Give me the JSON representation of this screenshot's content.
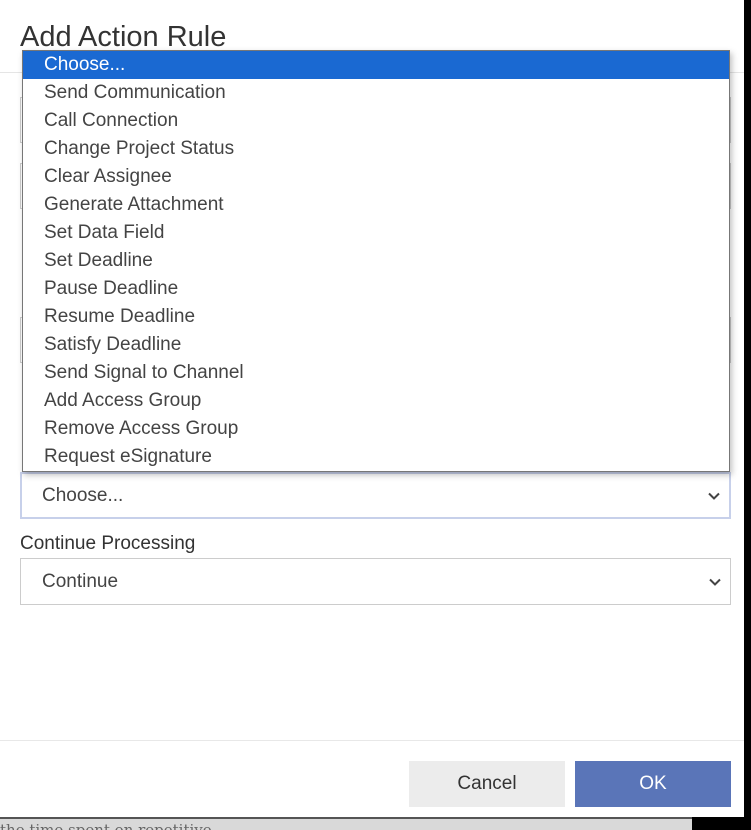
{
  "dialog": {
    "title": "Add Action Rule"
  },
  "action_select": {
    "value": "Choose...",
    "expanded": true,
    "options": [
      {
        "label": "Choose...",
        "selected": true
      },
      {
        "label": "Send Communication",
        "selected": false
      },
      {
        "label": "Call Connection",
        "selected": false
      },
      {
        "label": "Change Project Status",
        "selected": false
      },
      {
        "label": "Clear Assignee",
        "selected": false
      },
      {
        "label": "Generate Attachment",
        "selected": false
      },
      {
        "label": "Set Data Field",
        "selected": false
      },
      {
        "label": "Set Deadline",
        "selected": false
      },
      {
        "label": "Pause Deadline",
        "selected": false
      },
      {
        "label": "Resume Deadline",
        "selected": false
      },
      {
        "label": "Satisfy Deadline",
        "selected": false
      },
      {
        "label": "Send Signal to Channel",
        "selected": false
      },
      {
        "label": "Add Access Group",
        "selected": false
      },
      {
        "label": "Remove Access Group",
        "selected": false
      },
      {
        "label": "Request eSignature",
        "selected": false
      }
    ]
  },
  "continue_processing": {
    "label": "Continue Processing",
    "value": "Continue"
  },
  "footer": {
    "cancel_label": "Cancel",
    "ok_label": "OK"
  },
  "background": {
    "partial_text": "the time spent on repetitive"
  },
  "colors": {
    "selected_option": "#1a69d2",
    "ok_button": "#5a75b8",
    "cancel_button": "#ececec",
    "focus_border": "#c7d0ea"
  }
}
